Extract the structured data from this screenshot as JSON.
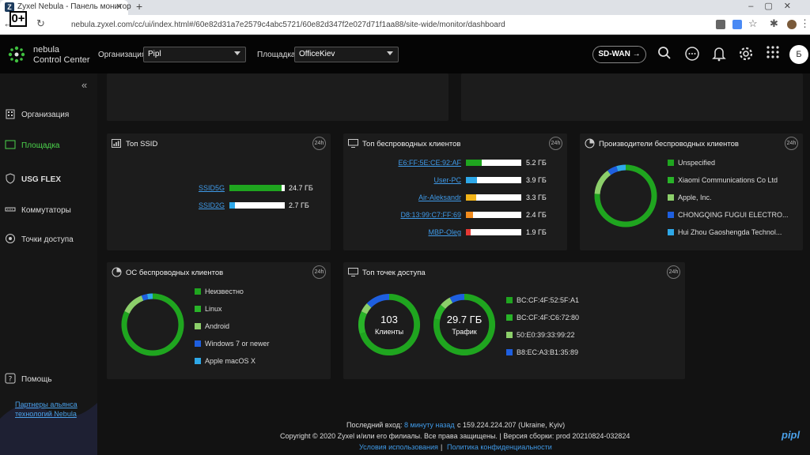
{
  "browser": {
    "tab_title": "Zyxel Nebula - Панель монитор",
    "favicon": "Z",
    "url": "nebula.zyxel.com/cc/ui/index.html#/60e82d31a7e2579c4abc5721/60e82d347f2e027d71f1aa88/site-wide/monitor/dashboard",
    "zoom_badge": "0+"
  },
  "header": {
    "logo_line1": "nebula",
    "logo_line2": "Control Center",
    "org_label": "Организация:",
    "org_value": "Pipl",
    "site_label": "Площадка:",
    "site_value": "OfficeKiev",
    "sdwan_label": "SD-WAN →",
    "avatar_letter": "Б"
  },
  "sidebar": {
    "items": [
      {
        "label": "Организация"
      },
      {
        "label": "Площадка"
      },
      {
        "label": "USG FLEX"
      },
      {
        "label": "Коммутаторы"
      },
      {
        "label": "Точки доступа"
      }
    ],
    "help": "Помощь",
    "partners": "Партнеры альянса технологий Nebula"
  },
  "cards": {
    "badge": "24h",
    "top_ssid": {
      "title": "Топ SSID",
      "rows": [
        {
          "name": "SSID5G",
          "value": "24.7 ГБ",
          "fraction": 0.94,
          "color": "#1fa51f"
        },
        {
          "name": "SSID2G",
          "value": "2.7 ГБ",
          "fraction": 0.1,
          "color": "#2ea8e8"
        }
      ]
    },
    "top_clients": {
      "title": "Топ беспроводных клиентов",
      "rows": [
        {
          "name": "E6:FF:5E:CE:92:AF",
          "value": "5.2 ГБ",
          "fraction": 0.28,
          "color": "#1fa51f"
        },
        {
          "name": "User-PC",
          "value": "3.9 ГБ",
          "fraction": 0.2,
          "color": "#2ea8e8"
        },
        {
          "name": "Air-Aleksandr",
          "value": "3.3 ГБ",
          "fraction": 0.18,
          "color": "#f2b418"
        },
        {
          "name": "D8:13:99:C7:FF:69",
          "value": "2.4 ГБ",
          "fraction": 0.13,
          "color": "#f28c1e"
        },
        {
          "name": "MBP-Oleg",
          "value": "1.9 ГБ",
          "fraction": 0.09,
          "color": "#e53935"
        }
      ]
    },
    "vendors": {
      "title": "Производители беспроводных клиентов",
      "legend": [
        {
          "label": "Unspecified",
          "color": "#1fa51f",
          "share": 0.76
        },
        {
          "label": "Xiaomi Communications Co Ltd",
          "color": "#28b328",
          "share": 0.0
        },
        {
          "label": "Apple, Inc.",
          "color": "#8ccf6a",
          "share": 0.14
        },
        {
          "label": "CHONGQING FUGUI ELECTRO...",
          "color": "#1e5fe0",
          "share": 0.05
        },
        {
          "label": "Hui Zhou Gaoshengda Technol...",
          "color": "#2ea8e8",
          "share": 0.05
        }
      ]
    },
    "os": {
      "title": "ОС беспроводных клиентов",
      "legend": [
        {
          "label": "Неизвестно",
          "color": "#1fa51f",
          "share": 0.82
        },
        {
          "label": "Linux",
          "color": "#28b328",
          "share": 0.0
        },
        {
          "label": "Android",
          "color": "#8ccf6a",
          "share": 0.12
        },
        {
          "label": "Windows 7 or newer",
          "color": "#1e5fe0",
          "share": 0.03
        },
        {
          "label": "Apple macOS X",
          "color": "#2ea8e8",
          "share": 0.03
        }
      ]
    },
    "top_ap": {
      "title": "Топ точек доступа",
      "clients_value": "103",
      "clients_label": "Клиенты",
      "traffic_value": "29.7 ГБ",
      "traffic_label": "Трафик",
      "legend": [
        {
          "label": "BC:CF:4F:52:5F:A1",
          "color": "#1fa51f"
        },
        {
          "label": "BC:CF:4F:C6:72:80",
          "color": "#28b328"
        },
        {
          "label": "50:E0:39:33:99:22",
          "color": "#8ccf6a"
        },
        {
          "label": "B8:EC:A3:B1:35:89",
          "color": "#1e5fe0"
        }
      ],
      "clients_shares": [
        0.7,
        0.12,
        0.05,
        0.13
      ],
      "traffic_shares": [
        0.78,
        0.08,
        0.06,
        0.08
      ]
    }
  },
  "footer": {
    "last_login_label": "Последний вход:",
    "last_login_time": "8 минуту назад",
    "last_login_from": "с 159.224.224.207 (Ukraine, Kyiv)",
    "copyright": "Copyright © 2020 Zyxel и/или его филиалы. Все права защищены. | Версия сборки: prod 20210824-032824",
    "terms": "Условия использования",
    "sep": "|",
    "privacy": "Политика конфиденциальности",
    "brand": "pipl"
  }
}
